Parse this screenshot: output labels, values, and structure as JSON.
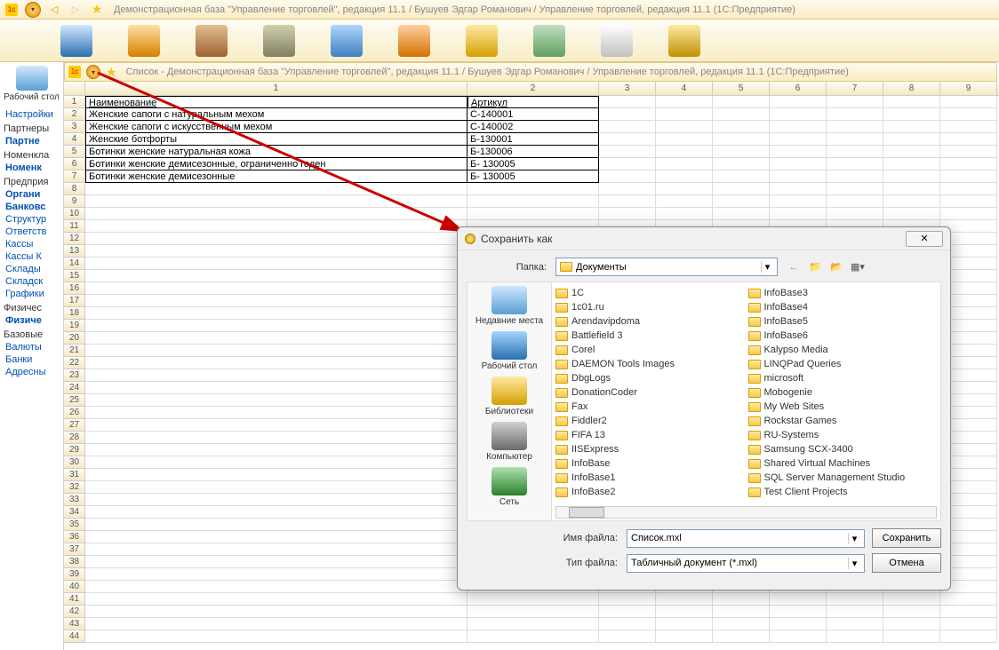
{
  "titlebar": {
    "title": "Демонстрационная база \"Управление торговлей\", редакция 11.1 / Бушуев Эдгар Романович / Управление торговлей, редакция 11.1  (1С:Предприятие)"
  },
  "sub_titlebar": {
    "title": "Список - Демонстрационная база \"Управление торговлей\", редакция 11.1 / Бушуев Эдгар Романович / Управление торговлей, редакция 11.1  (1С:Предприятие)"
  },
  "sidebar": {
    "tool": "Рабочий стол",
    "settings": "Настройки",
    "groups": [
      {
        "header": "Партнеры",
        "items": [
          {
            "t": "Партне",
            "bold": true
          }
        ]
      },
      {
        "header": "Номенкла",
        "items": [
          {
            "t": "Номенк",
            "bold": true
          }
        ]
      },
      {
        "header": "Предприя",
        "items": [
          {
            "t": "Органи",
            "bold": true
          },
          {
            "t": "Банковс",
            "bold": true
          },
          {
            "t": "Структур"
          },
          {
            "t": "Ответств"
          },
          {
            "t": "Кассы"
          },
          {
            "t": "Кассы К"
          },
          {
            "t": "Склады"
          },
          {
            "t": "Складск"
          },
          {
            "t": "Графики"
          }
        ]
      },
      {
        "header": "Физичес",
        "items": [
          {
            "t": "Физиче",
            "bold": true
          }
        ]
      },
      {
        "header": "Базовые",
        "items": [
          {
            "t": "Валюты"
          },
          {
            "t": "Банки"
          },
          {
            "t": "Адресны"
          }
        ]
      }
    ]
  },
  "sheet": {
    "col_headers": [
      "",
      "1",
      "2",
      "3",
      "4",
      "5",
      "6",
      "7",
      "8",
      "9"
    ],
    "header_row": {
      "name": "Наименование",
      "article": "Артикул"
    },
    "rows": [
      {
        "n": "2",
        "name": "Женские сапоги с натуральным мехом",
        "art": "С-140001"
      },
      {
        "n": "3",
        "name": "Женские сапоги с искусственным мехом",
        "art": "С-140002"
      },
      {
        "n": "4",
        "name": "Женские ботфорты",
        "art": "Б-130001"
      },
      {
        "n": "5",
        "name": "Ботинки женские натуральная кожа",
        "art": "Б-130006"
      },
      {
        "n": "6",
        "name": "Ботинки женские демисезонные, ограниченно годен",
        "art": "Б- 130005"
      },
      {
        "n": "7",
        "name": "Ботинки женские демисезонные",
        "art": "Б- 130005"
      }
    ],
    "empty_rows": [
      "8",
      "9",
      "10",
      "11",
      "12",
      "13",
      "14",
      "15",
      "16",
      "17",
      "18",
      "19",
      "20",
      "21",
      "22",
      "23",
      "24",
      "25",
      "26",
      "27",
      "28",
      "29",
      "30",
      "31",
      "32",
      "33",
      "34",
      "35",
      "36",
      "37",
      "38",
      "39",
      "40",
      "41",
      "42",
      "43",
      "44"
    ]
  },
  "dialog": {
    "title": "Сохранить как",
    "close": "✕",
    "folder_label": "Папка:",
    "folder_value": "Документы",
    "places": [
      {
        "label": "Недавние места",
        "color": "linear-gradient(#cfe7ff,#5a9fd4)"
      },
      {
        "label": "Рабочий стол",
        "color": "linear-gradient(#a3d4ff,#2a6fb0)"
      },
      {
        "label": "Библиотеки",
        "color": "linear-gradient(#ffe9a3,#d4a000)"
      },
      {
        "label": "Компьютер",
        "color": "linear-gradient(#d0d0d0,#6a6a6a)"
      },
      {
        "label": "Сеть",
        "color": "linear-gradient(#b0e0b0,#2a802a)"
      }
    ],
    "folders_left": [
      "1C",
      "1c01.ru",
      "Arendavipdoma",
      "Battlefield 3",
      "Corel",
      "DAEMON Tools Images",
      "DbgLogs",
      "DonationCoder",
      "Fax",
      "Fiddler2",
      "FIFA 13",
      "IISExpress",
      "InfoBase",
      "InfoBase1",
      "InfoBase2"
    ],
    "folders_right": [
      "InfoBase3",
      "InfoBase4",
      "InfoBase5",
      "InfoBase6",
      "Kalypso Media",
      "LINQPad Queries",
      "microsoft",
      "Mobogenie",
      "My Web Sites",
      "Rockstar Games",
      "RU-Systems",
      "Samsung SCX-3400",
      "Shared Virtual Machines",
      "SQL Server Management Studio",
      "Test Client Projects"
    ],
    "filename_label": "Имя файла:",
    "filename_value": "Список.mxl",
    "filetype_label": "Тип файла:",
    "filetype_value": "Табличный документ (*.mxl)",
    "save_btn": "Сохранить",
    "cancel_btn": "Отмена"
  }
}
